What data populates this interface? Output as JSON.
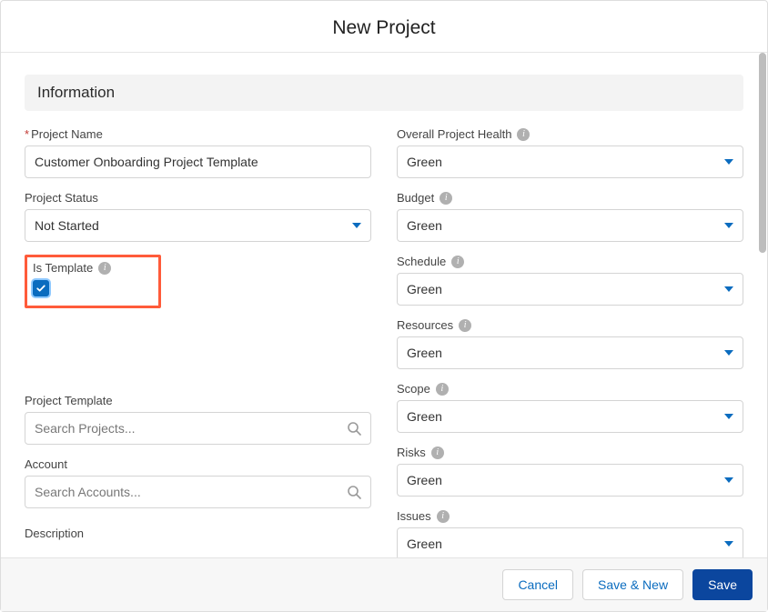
{
  "header": {
    "title": "New Project"
  },
  "section": {
    "title": "Information"
  },
  "left": {
    "projectName": {
      "label": "Project Name",
      "value": "Customer Onboarding Project Template"
    },
    "projectStatus": {
      "label": "Project Status",
      "value": "Not Started"
    },
    "isTemplate": {
      "label": "Is Template"
    },
    "projectTemplate": {
      "label": "Project Template",
      "placeholder": "Search Projects..."
    },
    "account": {
      "label": "Account",
      "placeholder": "Search Accounts..."
    },
    "description": {
      "label": "Description"
    }
  },
  "right": {
    "overallHealth": {
      "label": "Overall Project Health",
      "value": "Green"
    },
    "budget": {
      "label": "Budget",
      "value": "Green"
    },
    "schedule": {
      "label": "Schedule",
      "value": "Green"
    },
    "resources": {
      "label": "Resources",
      "value": "Green"
    },
    "scope": {
      "label": "Scope",
      "value": "Green"
    },
    "risks": {
      "label": "Risks",
      "value": "Green"
    },
    "issues": {
      "label": "Issues",
      "value": "Green"
    }
  },
  "footer": {
    "cancel": "Cancel",
    "saveNew": "Save & New",
    "save": "Save"
  }
}
